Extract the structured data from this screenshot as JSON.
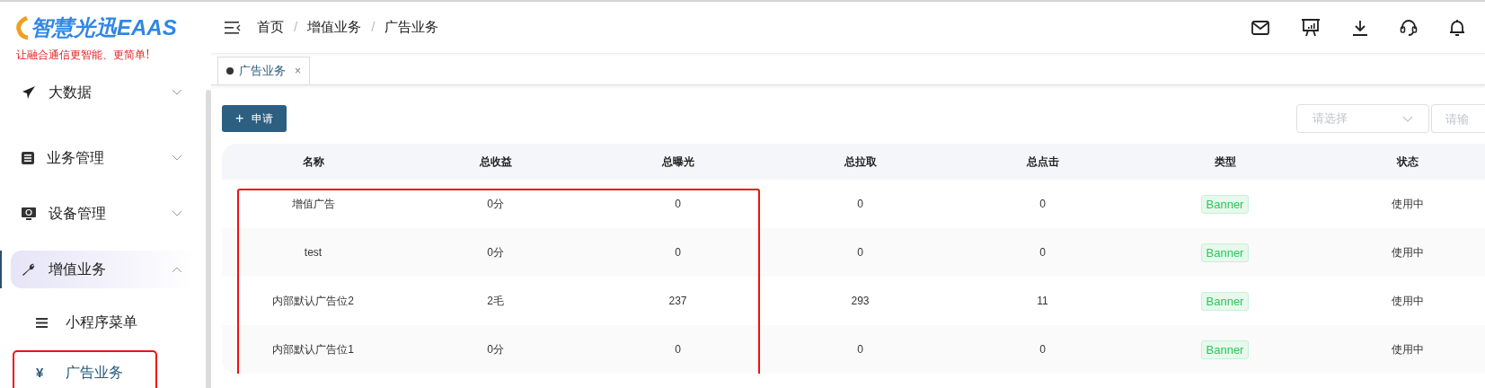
{
  "logo": {
    "title": "智慧光迅EAAS",
    "slogan": "让融合通信更智能、更简单!"
  },
  "sidebar": {
    "items": [
      {
        "label": "大数据",
        "expanded": false,
        "selected": false
      },
      {
        "label": "业务管理",
        "expanded": false,
        "selected": false
      },
      {
        "label": "设备管理",
        "expanded": false,
        "selected": false
      },
      {
        "label": "增值业务",
        "expanded": true,
        "selected": true,
        "children": [
          {
            "label": "小程序菜单",
            "selected": false,
            "annotated": false
          },
          {
            "label": "广告业务",
            "glyph": "¥",
            "selected": true,
            "annotated": true
          }
        ]
      }
    ]
  },
  "breadcrumb": {
    "separator": "/",
    "items": [
      "首页",
      "增值业务",
      "广告业务"
    ]
  },
  "tabs": [
    {
      "label": "广告业务",
      "selected": true,
      "close": "×"
    }
  ],
  "toolbar": {
    "button_icon": "+",
    "button": "申请",
    "select_placeholder": "请选择",
    "input_placeholder": "请输"
  },
  "table": {
    "annotated": true,
    "columns": [
      "名称",
      "总收益",
      "总曝光",
      "总拉取",
      "总点击",
      "类型",
      "状态"
    ],
    "rows": [
      [
        "增值广告",
        "0分",
        "0",
        "0",
        "0",
        "Banner",
        "使用中"
      ],
      [
        "test",
        "0分",
        "0",
        "0",
        "0",
        "Banner",
        "使用中"
      ],
      [
        "内部默认广告位2",
        "2毛",
        "237",
        "293",
        "11",
        "Banner",
        "使用中"
      ],
      [
        "内部默认广告位1",
        "0分",
        "0",
        "0",
        "0",
        "Banner",
        "使用中"
      ]
    ]
  }
}
